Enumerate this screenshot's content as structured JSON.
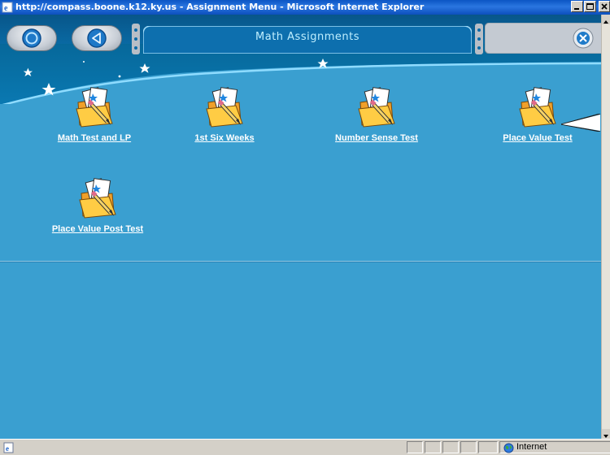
{
  "window": {
    "title": "http://compass.boone.k12.ky.us - Assignment Menu - Microsoft Internet Explorer"
  },
  "header": {
    "tab_title": "Math Assignments",
    "home_icon": "home-circle-icon",
    "back_icon": "back-arrow-icon",
    "close_icon": "close-x-icon"
  },
  "assignments": [
    {
      "label": "Math Test and LP",
      "icon": "assignment-folder-icon"
    },
    {
      "label": "1st Six Weeks",
      "icon": "assignment-folder-icon"
    },
    {
      "label": "Number Sense Test",
      "icon": "assignment-folder-icon"
    },
    {
      "label": "Place Value Test",
      "icon": "assignment-folder-icon"
    },
    {
      "label": "Place Value Post Test",
      "icon": "assignment-folder-icon"
    }
  ],
  "statusbar": {
    "zone_label": "Internet"
  },
  "colors": {
    "background": "#3a9fd0",
    "header_dark": "#0a5c8f",
    "tab_text": "#bfefff",
    "link_text": "#ffffff"
  }
}
